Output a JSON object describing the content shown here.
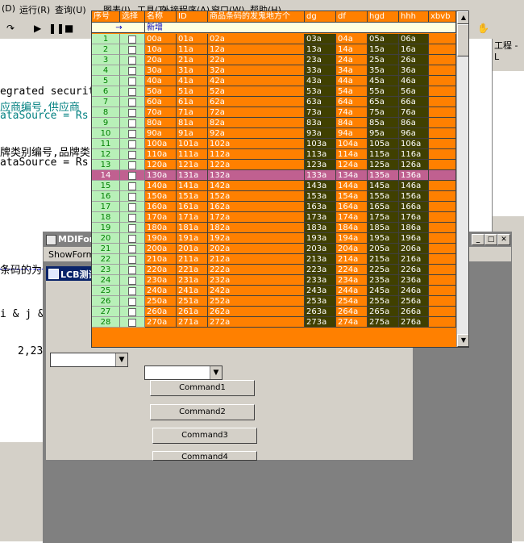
{
  "ide": {
    "menu": [
      "(D)",
      "运行(R)",
      "查询(U)",
      "图表(I)",
      "工具(T)",
      "外接程序(A)",
      "窗口(W)",
      "帮助(H)"
    ],
    "toolbar_icons": [
      "redo-icon",
      "play-icon",
      "pause-icon",
      "stop-icon"
    ],
    "code_lines": [
      "egrated security",
      "应商编号,供应商",
      "ataSource = Rs",
      "牌类别编号,品牌类",
      "ataSource = Rs",
      "条码的为",
      "i & j &",
      "2,23"
    ],
    "project_title": "工程 - L"
  },
  "mdi": {
    "title": "MDIForm",
    "menu": "ShowForm"
  },
  "child": {
    "title": "LCB测试",
    "buttons": [
      "Command1",
      "Command2",
      "Command3",
      "Command4"
    ]
  },
  "grid": {
    "headers": [
      "序号",
      "选择",
      "名称",
      "ID",
      "商品条码的发鬼地方个",
      "dg",
      "df",
      "hgd",
      "hhh",
      "xbvb"
    ],
    "new_row_marker": "→",
    "new_row_label": "新增",
    "selected_row": 14,
    "rows": [
      {
        "n": "1",
        "c": [
          "00a",
          "01a",
          "02a",
          "03a",
          "04a",
          "05a",
          "06a"
        ]
      },
      {
        "n": "2",
        "c": [
          "10a",
          "11a",
          "12a",
          "13a",
          "14a",
          "15a",
          "16a"
        ]
      },
      {
        "n": "3",
        "c": [
          "20a",
          "21a",
          "22a",
          "23a",
          "24a",
          "25a",
          "26a"
        ]
      },
      {
        "n": "4",
        "c": [
          "30a",
          "31a",
          "32a",
          "33a",
          "34a",
          "35a",
          "36a"
        ]
      },
      {
        "n": "5",
        "c": [
          "40a",
          "41a",
          "42a",
          "43a",
          "44a",
          "45a",
          "46a"
        ]
      },
      {
        "n": "6",
        "c": [
          "50a",
          "51a",
          "52a",
          "53a",
          "54a",
          "55a",
          "56a"
        ]
      },
      {
        "n": "7",
        "c": [
          "60a",
          "61a",
          "62a",
          "63a",
          "64a",
          "65a",
          "66a"
        ]
      },
      {
        "n": "8",
        "c": [
          "70a",
          "71a",
          "72a",
          "73a",
          "74a",
          "75a",
          "76a"
        ]
      },
      {
        "n": "9",
        "c": [
          "80a",
          "81a",
          "82a",
          "83a",
          "84a",
          "85a",
          "86a"
        ]
      },
      {
        "n": "10",
        "c": [
          "90a",
          "91a",
          "92a",
          "93a",
          "94a",
          "95a",
          "96a"
        ]
      },
      {
        "n": "11",
        "c": [
          "100a",
          "101a",
          "102a",
          "103a",
          "104a",
          "105a",
          "106a"
        ]
      },
      {
        "n": "12",
        "c": [
          "110a",
          "111a",
          "112a",
          "113a",
          "114a",
          "115a",
          "116a"
        ]
      },
      {
        "n": "13",
        "c": [
          "120a",
          "121a",
          "122a",
          "123a",
          "124a",
          "125a",
          "126a"
        ]
      },
      {
        "n": "14",
        "c": [
          "130a",
          "131a",
          "132a",
          "133a",
          "134a",
          "135a",
          "136a"
        ]
      },
      {
        "n": "15",
        "c": [
          "140a",
          "141a",
          "142a",
          "143a",
          "144a",
          "145a",
          "146a"
        ]
      },
      {
        "n": "16",
        "c": [
          "150a",
          "151a",
          "152a",
          "153a",
          "154a",
          "155a",
          "156a"
        ]
      },
      {
        "n": "17",
        "c": [
          "160a",
          "161a",
          "162a",
          "163a",
          "164a",
          "165a",
          "166a"
        ]
      },
      {
        "n": "18",
        "c": [
          "170a",
          "171a",
          "172a",
          "173a",
          "174a",
          "175a",
          "176a"
        ]
      },
      {
        "n": "19",
        "c": [
          "180a",
          "181a",
          "182a",
          "183a",
          "184a",
          "185a",
          "186a"
        ]
      },
      {
        "n": "20",
        "c": [
          "190a",
          "191a",
          "192a",
          "193a",
          "194a",
          "195a",
          "196a"
        ]
      },
      {
        "n": "21",
        "c": [
          "200a",
          "201a",
          "202a",
          "203a",
          "204a",
          "205a",
          "206a"
        ]
      },
      {
        "n": "22",
        "c": [
          "210a",
          "211a",
          "212a",
          "213a",
          "214a",
          "215a",
          "216a"
        ]
      },
      {
        "n": "23",
        "c": [
          "220a",
          "221a",
          "222a",
          "223a",
          "224a",
          "225a",
          "226a"
        ]
      },
      {
        "n": "24",
        "c": [
          "230a",
          "231a",
          "232a",
          "233a",
          "234a",
          "235a",
          "236a"
        ]
      },
      {
        "n": "25",
        "c": [
          "240a",
          "241a",
          "242a",
          "243a",
          "244a",
          "245a",
          "246a"
        ]
      },
      {
        "n": "26",
        "c": [
          "250a",
          "251a",
          "252a",
          "253a",
          "254a",
          "255a",
          "256a"
        ]
      },
      {
        "n": "27",
        "c": [
          "260a",
          "261a",
          "262a",
          "263a",
          "264a",
          "265a",
          "266a"
        ]
      },
      {
        "n": "28",
        "c": [
          "270a",
          "271a",
          "272a",
          "273a",
          "274a",
          "275a",
          "276a"
        ]
      }
    ]
  }
}
